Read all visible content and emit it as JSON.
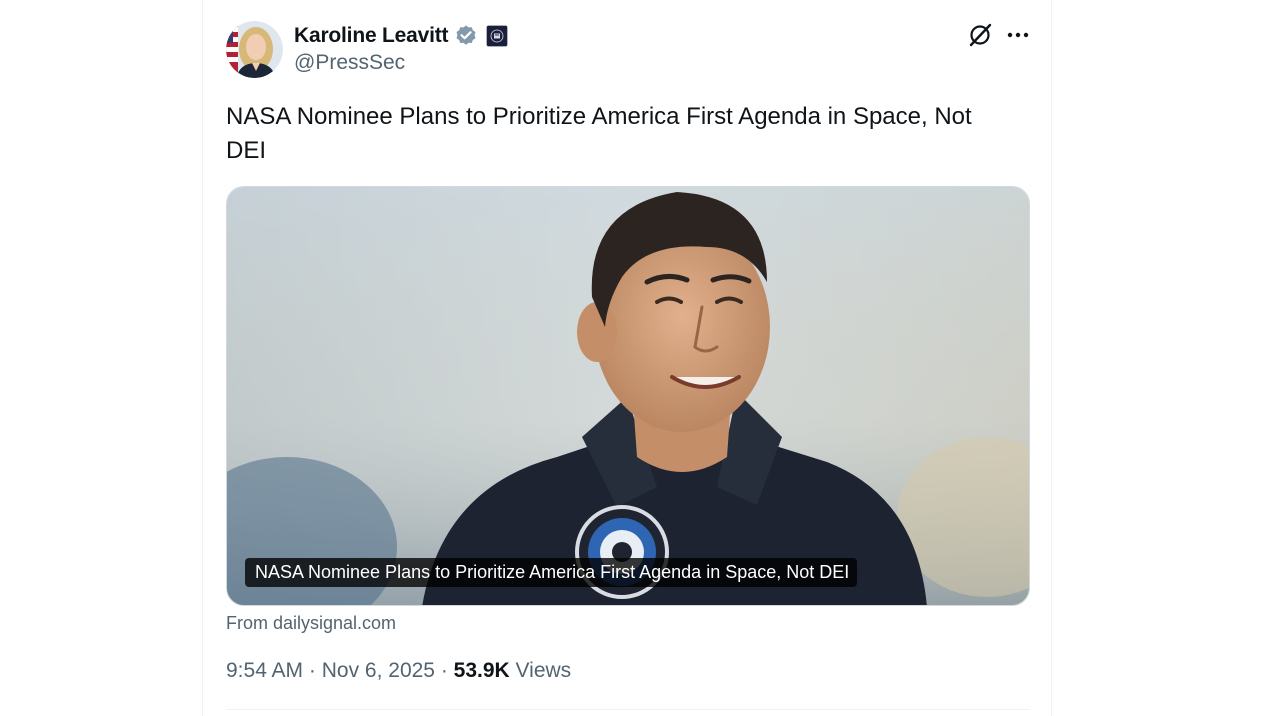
{
  "author": {
    "display_name": "Karoline Leavitt",
    "handle": "@PressSec",
    "verified_badge_color": "#829aab"
  },
  "tweet": {
    "text": "NASA Nominee Plans to Prioritize America First Agenda in Space, Not DEI"
  },
  "media": {
    "caption": "NASA Nominee Plans to Prioritize America First Agenda in Space, Not DEI",
    "image_description": "Smiling man with short dark hair in a dark flight suit with a Polaris mission patch"
  },
  "source": {
    "label": "From dailysignal.com"
  },
  "meta": {
    "time": "9:54 AM",
    "separator": " · ",
    "date": "Nov 6, 2025",
    "views_count": "53.9K",
    "views_label": " Views"
  },
  "icons": {
    "verified": "verified-badge-icon",
    "affiliation": "government-affiliation-icon",
    "grok": "grok-icon",
    "more": "more-horizontal-icon"
  },
  "colors": {
    "text_primary": "#0f1419",
    "text_secondary": "#536471",
    "border": "#eff3f4"
  }
}
